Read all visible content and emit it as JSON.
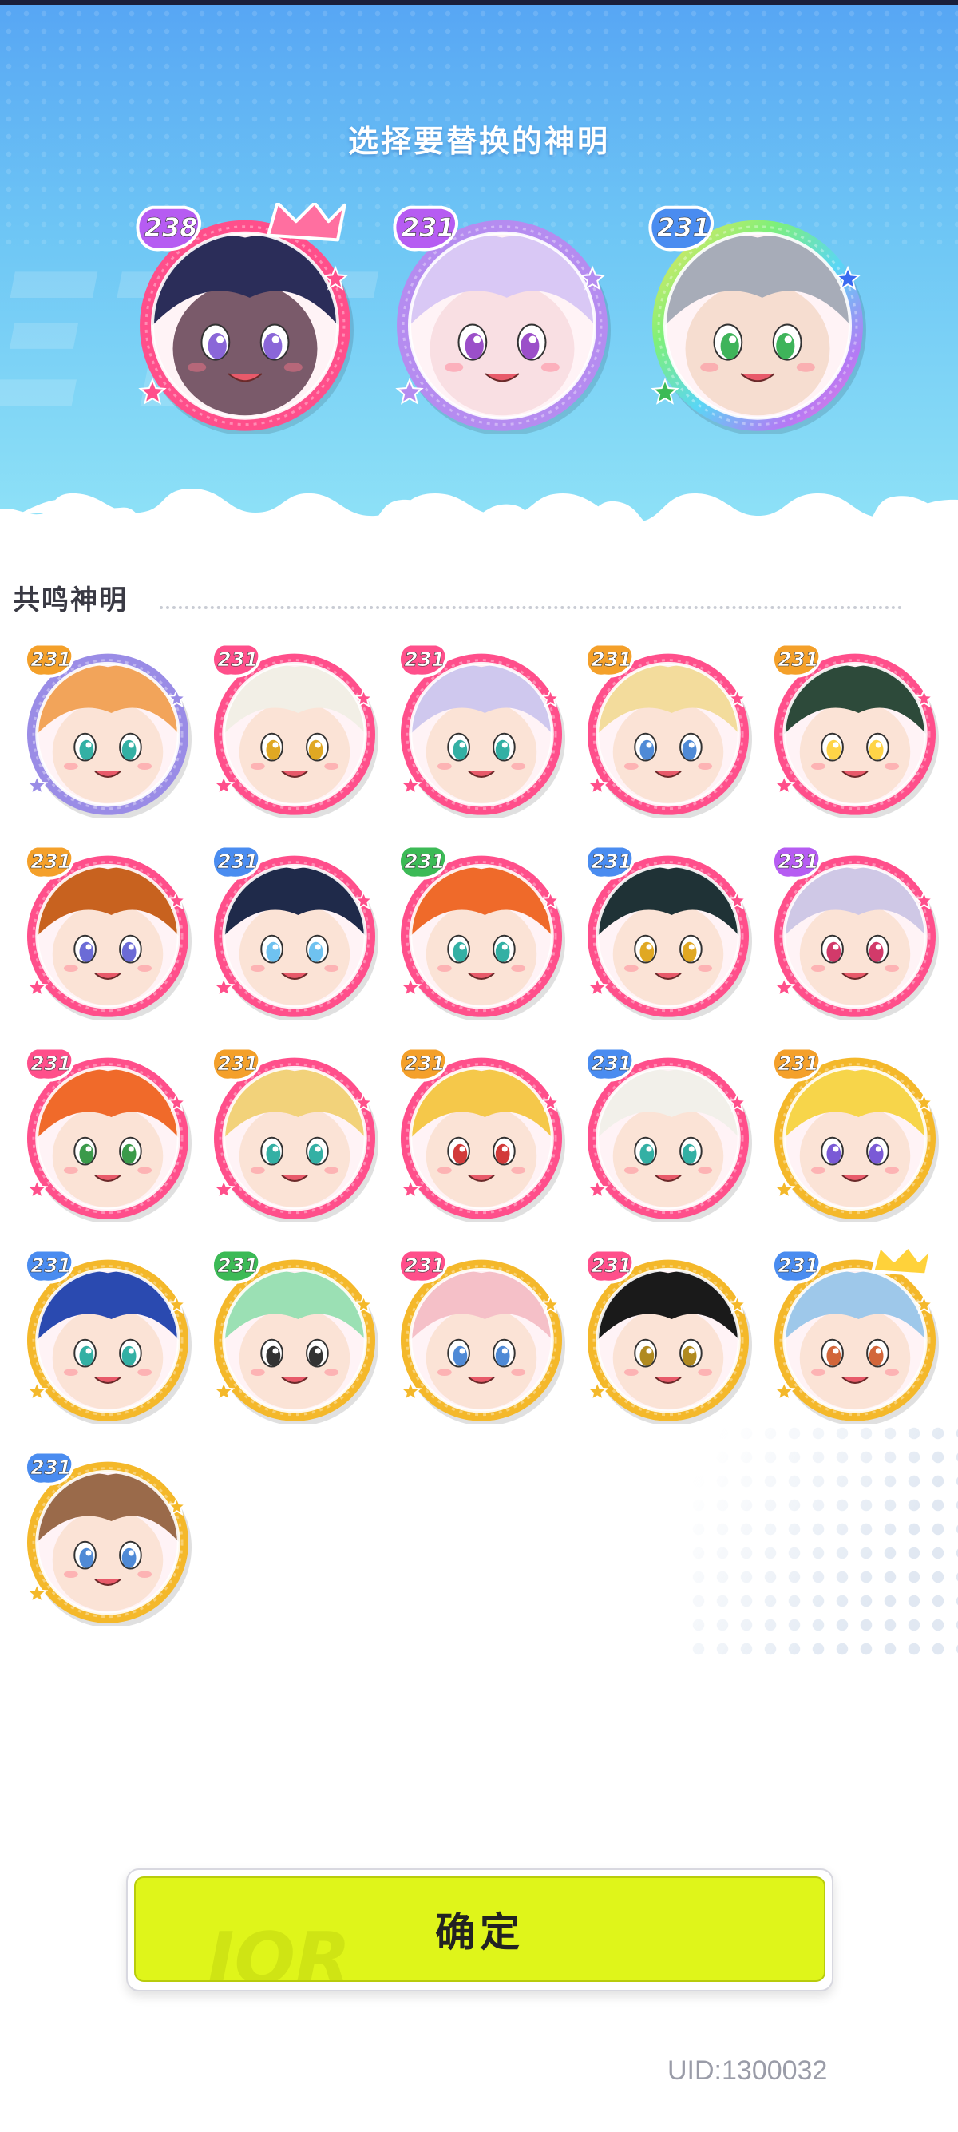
{
  "header": {
    "title": "选择要替换的神明"
  },
  "selected": [
    {
      "level": "238",
      "badge": "#b65cf2",
      "ring": "#ff4f8b",
      "crown": true,
      "hair": "#2b2d59",
      "skin": "#7a5a6a",
      "eye": "#8a66d8"
    },
    {
      "level": "231",
      "badge": "#b65cf2",
      "ring": "#b58cf0",
      "crown": false,
      "hair": "#d9c8f5",
      "skin": "#f9dfe3",
      "eye": "#9b4fc9"
    },
    {
      "level": "231",
      "badge": "#4a8cf0",
      "ring": "rainbow",
      "crown": false,
      "hair": "#a7acb8",
      "skin": "#f6ddd0",
      "eye": "#3eb45a"
    }
  ],
  "section": {
    "title": "共鸣神明"
  },
  "deities": [
    {
      "level": "231",
      "badge": "#f4a02a",
      "ring": "#9a8ce6",
      "hair": "#f2a45a",
      "eye": "#33b0a4",
      "crown": false
    },
    {
      "level": "231",
      "badge": "#ff4f8b",
      "ring": "#ff4f8b",
      "hair": "#f2efe6",
      "eye": "#e0a823",
      "crown": false
    },
    {
      "level": "231",
      "badge": "#ff4f8b",
      "ring": "#ff4f8b",
      "hair": "#cfc8ee",
      "eye": "#33b0a4",
      "crown": false
    },
    {
      "level": "231",
      "badge": "#f4a02a",
      "ring": "#ff4f8b",
      "hair": "#f3dc9c",
      "eye": "#4f8ad6",
      "crown": false
    },
    {
      "level": "231",
      "badge": "#f4a02a",
      "ring": "#ff4f8b",
      "hair": "#2d4a3a",
      "eye": "#ffd447",
      "crown": false
    },
    {
      "level": "231",
      "badge": "#f4a02a",
      "ring": "#ff4f8b",
      "hair": "#c8621f",
      "eye": "#6b6bd6",
      "crown": false
    },
    {
      "level": "231",
      "badge": "#4a8cf0",
      "ring": "#ff4f8b",
      "hair": "#1f2a4a",
      "eye": "#6fc2f0",
      "crown": false
    },
    {
      "level": "231",
      "badge": "#3cba56",
      "ring": "#ff4f8b",
      "hair": "#ef6a2a",
      "eye": "#33b0a4",
      "crown": false
    },
    {
      "level": "231",
      "badge": "#4a8cf0",
      "ring": "#ff4f8b",
      "hair": "#1f3236",
      "eye": "#e0a823",
      "crown": false
    },
    {
      "level": "231",
      "badge": "#b65cf2",
      "ring": "#ff4f8b",
      "hair": "#cfc8e6",
      "eye": "#d23a6a",
      "crown": false
    },
    {
      "level": "231",
      "badge": "#ff4f8b",
      "ring": "#ff4f8b",
      "hair": "#f06a2a",
      "eye": "#3a9a4a",
      "crown": false
    },
    {
      "level": "231",
      "badge": "#f4a02a",
      "ring": "#ff4f8b",
      "hair": "#f2d27a",
      "eye": "#33b0a4",
      "crown": false
    },
    {
      "level": "231",
      "badge": "#f4a02a",
      "ring": "#ff4f8b",
      "hair": "#f5c84a",
      "eye": "#d23a3a",
      "crown": false
    },
    {
      "level": "231",
      "badge": "#4a8cf0",
      "ring": "#ff4f8b",
      "hair": "#f2f0ea",
      "eye": "#33b0a4",
      "crown": false
    },
    {
      "level": "231",
      "badge": "#f4a02a",
      "ring": "#f4b82a",
      "hair": "#f7d54a",
      "eye": "#7a5ad6",
      "crown": false
    },
    {
      "level": "231",
      "badge": "#4a8cf0",
      "ring": "#f4b82a",
      "hair": "#2a4ab0",
      "eye": "#33b0a4",
      "crown": false
    },
    {
      "level": "231",
      "badge": "#3cba56",
      "ring": "#f4b82a",
      "hair": "#9be0b4",
      "eye": "#333333",
      "crown": false
    },
    {
      "level": "231",
      "badge": "#ff4f8b",
      "ring": "#f4b82a",
      "hair": "#f5c0c8",
      "eye": "#4f8ad6",
      "crown": false
    },
    {
      "level": "231",
      "badge": "#ff4f8b",
      "ring": "#f4b82a",
      "hair": "#1a1a1a",
      "eye": "#b08a20",
      "crown": false
    },
    {
      "level": "231",
      "badge": "#4a8cf0",
      "ring": "#f4b82a",
      "hair": "#9ec8ea",
      "eye": "#d2663a",
      "crown": true
    },
    {
      "level": "231",
      "badge": "#4a8cf0",
      "ring": "#f4b82a",
      "hair": "#9a6a4a",
      "eye": "#4f8ad6",
      "crown": false
    }
  ],
  "actions": {
    "confirm_label": "确定"
  },
  "footer": {
    "uid": "UID:1300032"
  }
}
